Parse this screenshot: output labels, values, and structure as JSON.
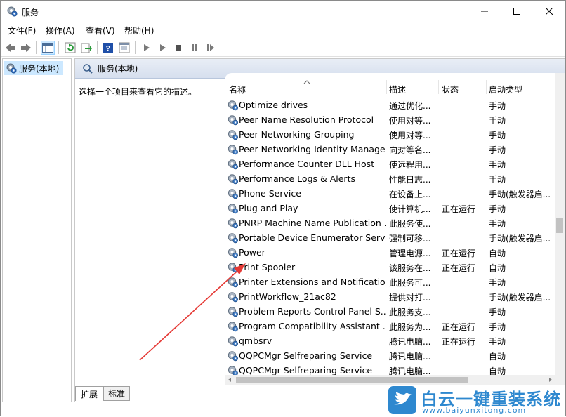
{
  "window": {
    "title": "服务"
  },
  "menu": [
    "文件(F)",
    "操作(A)",
    "查看(V)",
    "帮助(H)"
  ],
  "tree": {
    "root": "服务(本地)"
  },
  "panel": {
    "header": "服务(本地)",
    "hint": "选择一个项目来查看它的描述。",
    "columns": {
      "name": "名称",
      "desc": "描述",
      "status": "状态",
      "start": "启动类型"
    }
  },
  "rows": [
    {
      "name": "Optimize drives",
      "desc": "通过优化...",
      "status": "",
      "start": "手动"
    },
    {
      "name": "Peer Name Resolution Protocol",
      "desc": "使用对等...",
      "status": "",
      "start": "手动"
    },
    {
      "name": "Peer Networking Grouping",
      "desc": "使用对等...",
      "status": "",
      "start": "手动"
    },
    {
      "name": "Peer Networking Identity Manager",
      "desc": "向对等名...",
      "status": "",
      "start": "手动"
    },
    {
      "name": "Performance Counter DLL Host",
      "desc": "使远程用...",
      "status": "",
      "start": "手动"
    },
    {
      "name": "Performance Logs & Alerts",
      "desc": "性能日志...",
      "status": "",
      "start": "手动"
    },
    {
      "name": "Phone Service",
      "desc": "在设备上...",
      "status": "",
      "start": "手动(触发器启..."
    },
    {
      "name": "Plug and Play",
      "desc": "使计算机...",
      "status": "正在运行",
      "start": "手动"
    },
    {
      "name": "PNRP Machine Name Publication ...",
      "desc": "此服务使...",
      "status": "",
      "start": "手动"
    },
    {
      "name": "Portable Device Enumerator Servi...",
      "desc": "强制可移...",
      "status": "",
      "start": "手动(触发器启..."
    },
    {
      "name": "Power",
      "desc": "管理电源...",
      "status": "正在运行",
      "start": "自动"
    },
    {
      "name": "Print Spooler",
      "desc": "该服务在...",
      "status": "正在运行",
      "start": "自动"
    },
    {
      "name": "Printer Extensions and Notificatio...",
      "desc": "此服务可...",
      "status": "",
      "start": "手动"
    },
    {
      "name": "PrintWorkflow_21ac82",
      "desc": "提供对打...",
      "status": "",
      "start": "手动(触发器启..."
    },
    {
      "name": "Problem Reports Control Panel S...",
      "desc": "此服务支...",
      "status": "",
      "start": "手动"
    },
    {
      "name": "Program Compatibility Assistant ...",
      "desc": "此服务为...",
      "status": "正在运行",
      "start": "手动"
    },
    {
      "name": "qmbsrv",
      "desc": "腾讯电脑...",
      "status": "正在运行",
      "start": "手动"
    },
    {
      "name": "QQPCMgr Selfreparing Service",
      "desc": "腾讯电脑...",
      "status": "",
      "start": "自动"
    },
    {
      "name": "QQPCMgr Selfreparing Service",
      "desc": "腾讯电脑...",
      "status": "",
      "start": "自动"
    }
  ],
  "tabs": {
    "extended": "扩展",
    "standard": "标准"
  },
  "watermark": {
    "title": "白云一键重装系统",
    "url": "www.baiyunxitong.com"
  },
  "colors": {
    "selection": "#cce8ff",
    "accent": "#2e88cf",
    "annotation": "#e53935"
  }
}
